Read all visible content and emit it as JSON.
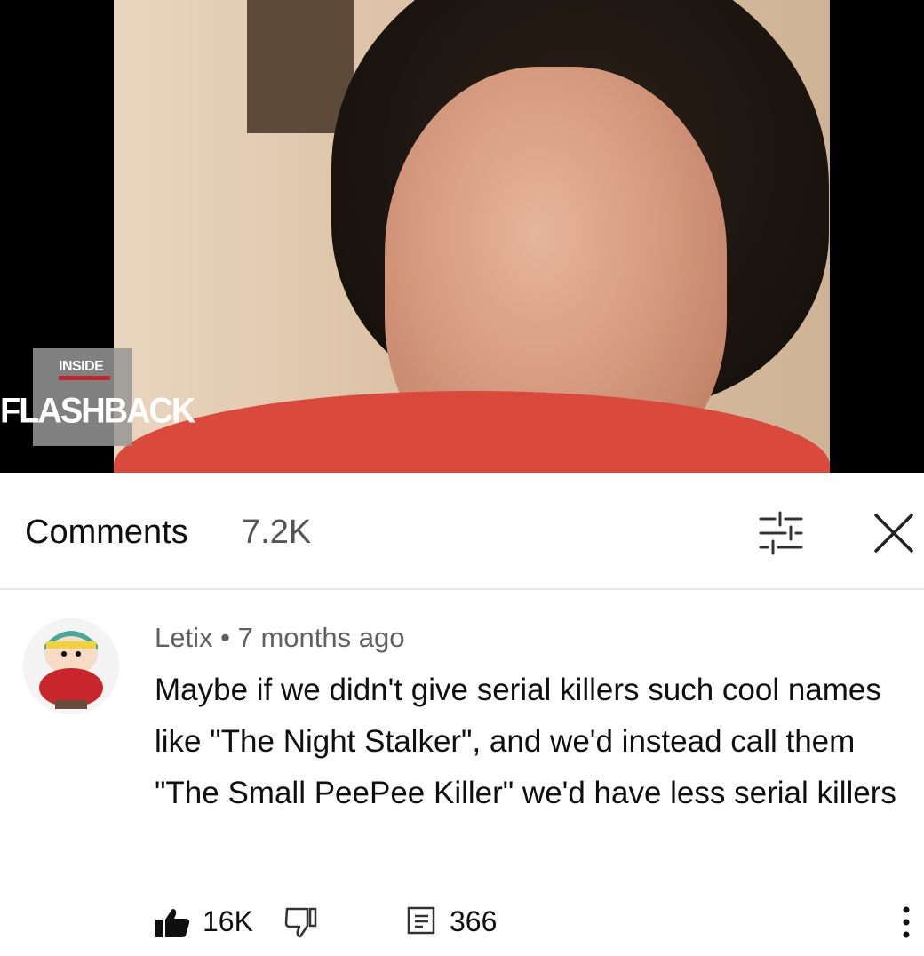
{
  "video": {
    "badge_top": "INSIDE",
    "badge_main": "FLASHBACK"
  },
  "comments_header": {
    "title": "Comments",
    "count": "7.2K",
    "sort_icon": "sort-filter-icon",
    "close_icon": "close-icon"
  },
  "comment": {
    "author": "Letix",
    "separator": "•",
    "age": "7 months ago",
    "text": "Maybe if we didn't give serial killers such cool names like \"The Night Stalker\", and we'd instead call them \"The Small PeePee Killer\" we'd have less serial killers",
    "likes": "16K",
    "replies": "366",
    "icons": [
      "thumbs-up-icon",
      "thumbs-down-icon",
      "reply-icon",
      "more-vertical-icon"
    ]
  }
}
